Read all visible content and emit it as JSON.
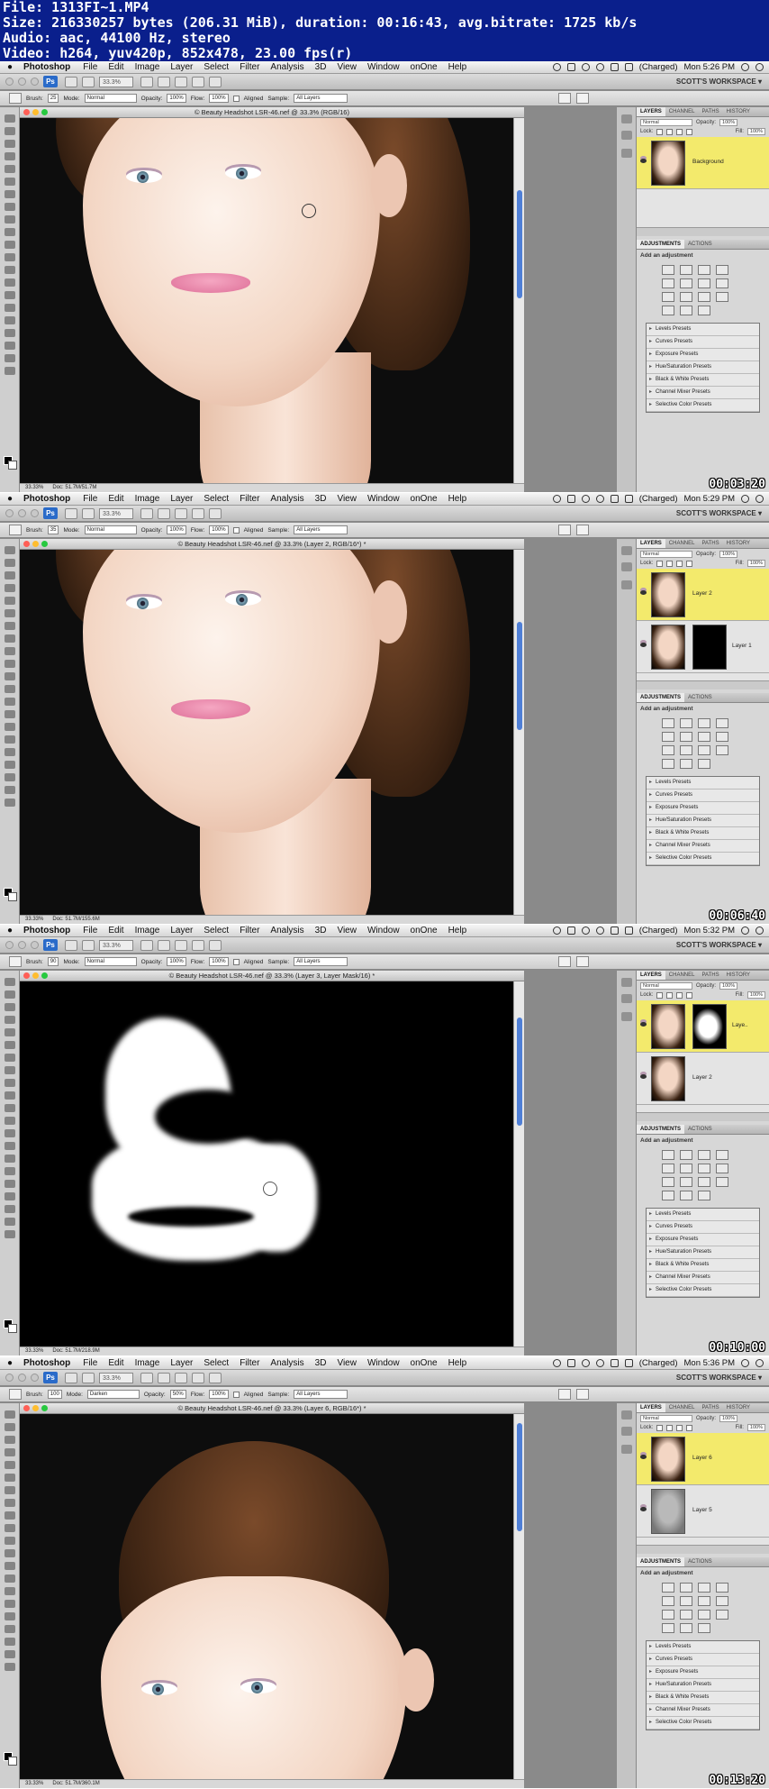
{
  "header": {
    "file": "File: 1313FI~1.MP4",
    "size": "Size: 216330257 bytes (206.31 MiB), duration: 00:16:43, avg.bitrate: 1725 kb/s",
    "audio": "Audio: aac, 44100 Hz, stereo",
    "video": "Video: h264, yuv420p, 852x478, 23.00 fps(r)"
  },
  "menubar": {
    "app": "Photoshop",
    "items": [
      "File",
      "Edit",
      "Image",
      "Layer",
      "Select",
      "Filter",
      "Analysis",
      "3D",
      "View",
      "Window",
      "onOne",
      "Help"
    ],
    "battery": "(Charged)"
  },
  "appbar": {
    "ps_badge": "Ps",
    "zoom": "33.3%",
    "workspace": "SCOTT'S WORKSPACE ▾"
  },
  "options": {
    "brush_label": "Brush:",
    "mode_label": "Mode:",
    "opacity_label": "Opacity:",
    "flow_label": "Flow:",
    "aligned_label": "Aligned",
    "sample_label": "Sample:",
    "sample_value": "All Layers",
    "percent_100": "100%"
  },
  "panels": {
    "tab_layers": "LAYERS",
    "tab_channels": "CHANNEL",
    "tab_paths": "PATHS",
    "tab_history": "HISTORY",
    "tab_adjustments": "ADJUSTMENTS",
    "tab_actions": "ACTIONS",
    "normal": "Normal",
    "opacity_label": "Opacity:",
    "fill_label": "Fill:",
    "lock_label": "Lock:",
    "add_adjustment": "Add an adjustment",
    "presets": [
      "Levels Presets",
      "Curves Presets",
      "Exposure Presets",
      "Hue/Saturation Presets",
      "Black & White Presets",
      "Channel Mixer Presets",
      "Selective Color Presets"
    ]
  },
  "frames": [
    {
      "clock": "Mon 5:26 PM",
      "brush_size": "25",
      "mode": "Normal",
      "opacity": "100%",
      "flow": "100%",
      "doc_title": "© Beauty Headshot LSR-46.nef @ 33.3% (RGB/16)",
      "status_zoom": "33.33%",
      "status_doc": "Doc: 51.7M/51.7M",
      "layers": [
        {
          "name": "Background",
          "selected": true
        }
      ],
      "timecode": "00:03:20"
    },
    {
      "clock": "Mon 5:29 PM",
      "brush_size": "35",
      "mode": "Normal",
      "opacity": "100%",
      "flow": "100%",
      "doc_title": "© Beauty Headshot LSR-46.nef @ 33.3% (Layer 2, RGB/16*) *",
      "status_zoom": "33.33%",
      "status_doc": "Doc: 51.7M/155.6M",
      "layers": [
        {
          "name": "Layer 2",
          "selected": true
        },
        {
          "name": "Layer 1",
          "selected": false
        }
      ],
      "timecode": "00:06:40"
    },
    {
      "clock": "Mon 5:32 PM",
      "brush_size": "90",
      "mode": "Normal",
      "opacity": "100%",
      "flow": "100%",
      "doc_title": "© Beauty Headshot LSR-46.nef @ 33.3% (Layer 3, Layer Mask/16) *",
      "status_zoom": "33.33%",
      "status_doc": "Doc: 51.7M/218.9M",
      "layers": [
        {
          "name": "Laye..",
          "selected": true
        },
        {
          "name": "Layer 2",
          "selected": false
        }
      ],
      "timecode": "00:10:00"
    },
    {
      "clock": "Mon 5:36 PM",
      "brush_size": "100",
      "mode": "Darken",
      "opacity": "50%",
      "flow": "100%",
      "doc_title": "© Beauty Headshot LSR-46.nef @ 33.3% (Layer 6, RGB/16*) *",
      "status_zoom": "33.33%",
      "status_doc": "Doc: 51.7M/360.1M",
      "layers": [
        {
          "name": "Layer 6",
          "selected": true
        },
        {
          "name": "Layer 5",
          "selected": false
        }
      ],
      "timecode": "00:13:20"
    }
  ]
}
